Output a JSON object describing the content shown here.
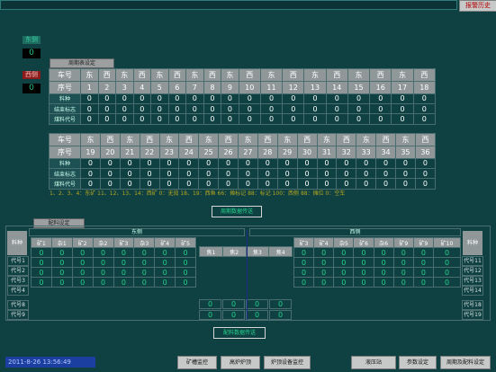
{
  "header": {
    "title_field": "",
    "alarm_history_label": "报警历史"
  },
  "side": {
    "east_label": "东侧",
    "east_value": "0",
    "west_label": "西侧",
    "west_value": "0"
  },
  "cycle_table": {
    "tab_label": "周期表设定",
    "row_labels": [
      "车号",
      "序号",
      "料种",
      "结束标志",
      "煤料代号"
    ],
    "block1": {
      "dirs": [
        "东",
        "西",
        "东",
        "西",
        "东",
        "西",
        "东",
        "西",
        "东",
        "西",
        "东",
        "西",
        "东",
        "西",
        "东",
        "西",
        "东",
        "西"
      ],
      "seq": [
        "1",
        "2",
        "3",
        "4",
        "5",
        "6",
        "7",
        "8",
        "9",
        "10",
        "11",
        "12",
        "13",
        "14",
        "15",
        "16",
        "17",
        "18"
      ],
      "values": [
        "0",
        "0",
        "0",
        "0",
        "0",
        "0",
        "0",
        "0",
        "0",
        "0",
        "0",
        "0",
        "0",
        "0",
        "0",
        "0",
        "0",
        "0"
      ]
    },
    "block2": {
      "dirs": [
        "东",
        "西",
        "东",
        "西",
        "东",
        "西",
        "东",
        "西",
        "东",
        "西",
        "东",
        "西",
        "东",
        "西",
        "东",
        "西",
        "东",
        "西"
      ],
      "seq": [
        "19",
        "20",
        "21",
        "22",
        "23",
        "24",
        "25",
        "26",
        "27",
        "28",
        "29",
        "30",
        "31",
        "32",
        "33",
        "34",
        "35",
        "36"
      ],
      "values": [
        "0",
        "0",
        "0",
        "0",
        "0",
        "0",
        "0",
        "0",
        "0",
        "0",
        "0",
        "0",
        "0",
        "0",
        "0",
        "0",
        "0",
        "0"
      ]
    },
    "legend": "1、2、3、4：东矿   11、12、13、14：西矿   0：无效   18、19：西鱼       66：摊标记  88：标记  100：西侧  88：摊位  0：空车",
    "send_button": "周期数据传送"
  },
  "config": {
    "tab_label": "配料设定",
    "east_title": "东侧",
    "west_title": "西侧",
    "material_label": "料种",
    "east_sub": [
      "矿1",
      "杂1",
      "矿2",
      "杂2",
      "矿3",
      "杂3",
      "矿4",
      "矿5"
    ],
    "center_sub": [
      "焦1",
      "焦2",
      "焦3",
      "焦4"
    ],
    "west_sub": [
      "矿3",
      "矿4",
      "杂5",
      "矿6",
      "杂6",
      "矿9",
      "矿9",
      "矿10"
    ],
    "left_codes": [
      "代号1",
      "代号2",
      "代号3",
      "代号4",
      "代号8",
      "代号9"
    ],
    "right_codes": [
      "代号11",
      "代号12",
      "代号13",
      "代号14",
      "代号18",
      "代号19"
    ],
    "east_rows": [
      [
        "0",
        "0",
        "0",
        "0",
        "0",
        "0",
        "0",
        "0"
      ],
      [
        "0",
        "0",
        "0",
        "0",
        "0",
        "0",
        "0",
        "0"
      ],
      [
        "0",
        "0",
        "0",
        "0",
        "0",
        "0",
        "0",
        "0"
      ],
      [
        "0",
        "0",
        "0",
        "0",
        "0",
        "0",
        "0",
        "0"
      ]
    ],
    "west_rows": [
      [
        "0",
        "0",
        "0",
        "0",
        "0",
        "0",
        "0",
        "0"
      ],
      [
        "0",
        "0",
        "0",
        "0",
        "0",
        "0",
        "0",
        "0"
      ],
      [
        "0",
        "0",
        "0",
        "0",
        "0",
        "0",
        "0",
        "0"
      ],
      [
        "0",
        "0",
        "0",
        "0",
        "0",
        "0",
        "0",
        "0"
      ]
    ],
    "center_rows": [
      [
        "0",
        "0",
        "0",
        "0"
      ],
      [
        "0",
        "0",
        "0",
        "0"
      ]
    ],
    "send_button": "配料数据传送"
  },
  "footer": {
    "datetime": "2011-8-26 13:56:49",
    "nav": [
      "矿槽监控",
      "高炉炉顶",
      "炉顶设备监控",
      "液压站",
      "参数设定",
      "周期及配料设定"
    ]
  },
  "colors": {
    "background": "#0f4143",
    "value_green": "#26cf88",
    "header_gray": "#8f9798",
    "highlight_green": "#2e8a40"
  }
}
